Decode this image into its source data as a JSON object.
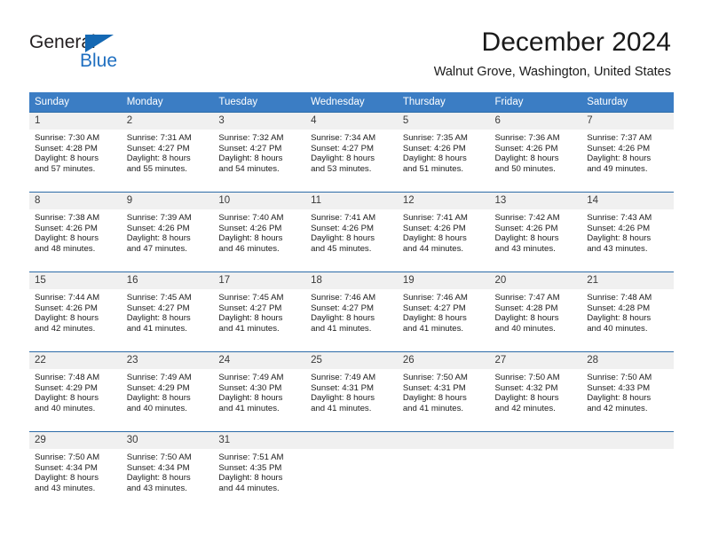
{
  "brand": {
    "name_part1": "General",
    "name_part2": "Blue",
    "triangle_color": "#1468b3"
  },
  "header": {
    "title": "December 2024",
    "location": "Walnut Grove, Washington, United States"
  },
  "colors": {
    "header_blue": "#3b7dc4",
    "cell_border_blue": "#2d6ca8",
    "daynum_band": "#f0f0f0",
    "brand_blue": "#1f6fc0"
  },
  "weekday_headers": [
    "Sunday",
    "Monday",
    "Tuesday",
    "Wednesday",
    "Thursday",
    "Friday",
    "Saturday"
  ],
  "labels": {
    "sunrise_prefix": "Sunrise:",
    "sunset_prefix": "Sunset:",
    "daylight_prefix": "Daylight:"
  },
  "weeks": [
    [
      {
        "day": "1",
        "sunrise": "Sunrise: 7:30 AM",
        "sunset": "Sunset: 4:28 PM",
        "daylight_line1": "Daylight: 8 hours",
        "daylight_line2": "and 57 minutes."
      },
      {
        "day": "2",
        "sunrise": "Sunrise: 7:31 AM",
        "sunset": "Sunset: 4:27 PM",
        "daylight_line1": "Daylight: 8 hours",
        "daylight_line2": "and 55 minutes."
      },
      {
        "day": "3",
        "sunrise": "Sunrise: 7:32 AM",
        "sunset": "Sunset: 4:27 PM",
        "daylight_line1": "Daylight: 8 hours",
        "daylight_line2": "and 54 minutes."
      },
      {
        "day": "4",
        "sunrise": "Sunrise: 7:34 AM",
        "sunset": "Sunset: 4:27 PM",
        "daylight_line1": "Daylight: 8 hours",
        "daylight_line2": "and 53 minutes."
      },
      {
        "day": "5",
        "sunrise": "Sunrise: 7:35 AM",
        "sunset": "Sunset: 4:26 PM",
        "daylight_line1": "Daylight: 8 hours",
        "daylight_line2": "and 51 minutes."
      },
      {
        "day": "6",
        "sunrise": "Sunrise: 7:36 AM",
        "sunset": "Sunset: 4:26 PM",
        "daylight_line1": "Daylight: 8 hours",
        "daylight_line2": "and 50 minutes."
      },
      {
        "day": "7",
        "sunrise": "Sunrise: 7:37 AM",
        "sunset": "Sunset: 4:26 PM",
        "daylight_line1": "Daylight: 8 hours",
        "daylight_line2": "and 49 minutes."
      }
    ],
    [
      {
        "day": "8",
        "sunrise": "Sunrise: 7:38 AM",
        "sunset": "Sunset: 4:26 PM",
        "daylight_line1": "Daylight: 8 hours",
        "daylight_line2": "and 48 minutes."
      },
      {
        "day": "9",
        "sunrise": "Sunrise: 7:39 AM",
        "sunset": "Sunset: 4:26 PM",
        "daylight_line1": "Daylight: 8 hours",
        "daylight_line2": "and 47 minutes."
      },
      {
        "day": "10",
        "sunrise": "Sunrise: 7:40 AM",
        "sunset": "Sunset: 4:26 PM",
        "daylight_line1": "Daylight: 8 hours",
        "daylight_line2": "and 46 minutes."
      },
      {
        "day": "11",
        "sunrise": "Sunrise: 7:41 AM",
        "sunset": "Sunset: 4:26 PM",
        "daylight_line1": "Daylight: 8 hours",
        "daylight_line2": "and 45 minutes."
      },
      {
        "day": "12",
        "sunrise": "Sunrise: 7:41 AM",
        "sunset": "Sunset: 4:26 PM",
        "daylight_line1": "Daylight: 8 hours",
        "daylight_line2": "and 44 minutes."
      },
      {
        "day": "13",
        "sunrise": "Sunrise: 7:42 AM",
        "sunset": "Sunset: 4:26 PM",
        "daylight_line1": "Daylight: 8 hours",
        "daylight_line2": "and 43 minutes."
      },
      {
        "day": "14",
        "sunrise": "Sunrise: 7:43 AM",
        "sunset": "Sunset: 4:26 PM",
        "daylight_line1": "Daylight: 8 hours",
        "daylight_line2": "and 43 minutes."
      }
    ],
    [
      {
        "day": "15",
        "sunrise": "Sunrise: 7:44 AM",
        "sunset": "Sunset: 4:26 PM",
        "daylight_line1": "Daylight: 8 hours",
        "daylight_line2": "and 42 minutes."
      },
      {
        "day": "16",
        "sunrise": "Sunrise: 7:45 AM",
        "sunset": "Sunset: 4:27 PM",
        "daylight_line1": "Daylight: 8 hours",
        "daylight_line2": "and 41 minutes."
      },
      {
        "day": "17",
        "sunrise": "Sunrise: 7:45 AM",
        "sunset": "Sunset: 4:27 PM",
        "daylight_line1": "Daylight: 8 hours",
        "daylight_line2": "and 41 minutes."
      },
      {
        "day": "18",
        "sunrise": "Sunrise: 7:46 AM",
        "sunset": "Sunset: 4:27 PM",
        "daylight_line1": "Daylight: 8 hours",
        "daylight_line2": "and 41 minutes."
      },
      {
        "day": "19",
        "sunrise": "Sunrise: 7:46 AM",
        "sunset": "Sunset: 4:27 PM",
        "daylight_line1": "Daylight: 8 hours",
        "daylight_line2": "and 41 minutes."
      },
      {
        "day": "20",
        "sunrise": "Sunrise: 7:47 AM",
        "sunset": "Sunset: 4:28 PM",
        "daylight_line1": "Daylight: 8 hours",
        "daylight_line2": "and 40 minutes."
      },
      {
        "day": "21",
        "sunrise": "Sunrise: 7:48 AM",
        "sunset": "Sunset: 4:28 PM",
        "daylight_line1": "Daylight: 8 hours",
        "daylight_line2": "and 40 minutes."
      }
    ],
    [
      {
        "day": "22",
        "sunrise": "Sunrise: 7:48 AM",
        "sunset": "Sunset: 4:29 PM",
        "daylight_line1": "Daylight: 8 hours",
        "daylight_line2": "and 40 minutes."
      },
      {
        "day": "23",
        "sunrise": "Sunrise: 7:49 AM",
        "sunset": "Sunset: 4:29 PM",
        "daylight_line1": "Daylight: 8 hours",
        "daylight_line2": "and 40 minutes."
      },
      {
        "day": "24",
        "sunrise": "Sunrise: 7:49 AM",
        "sunset": "Sunset: 4:30 PM",
        "daylight_line1": "Daylight: 8 hours",
        "daylight_line2": "and 41 minutes."
      },
      {
        "day": "25",
        "sunrise": "Sunrise: 7:49 AM",
        "sunset": "Sunset: 4:31 PM",
        "daylight_line1": "Daylight: 8 hours",
        "daylight_line2": "and 41 minutes."
      },
      {
        "day": "26",
        "sunrise": "Sunrise: 7:50 AM",
        "sunset": "Sunset: 4:31 PM",
        "daylight_line1": "Daylight: 8 hours",
        "daylight_line2": "and 41 minutes."
      },
      {
        "day": "27",
        "sunrise": "Sunrise: 7:50 AM",
        "sunset": "Sunset: 4:32 PM",
        "daylight_line1": "Daylight: 8 hours",
        "daylight_line2": "and 42 minutes."
      },
      {
        "day": "28",
        "sunrise": "Sunrise: 7:50 AM",
        "sunset": "Sunset: 4:33 PM",
        "daylight_line1": "Daylight: 8 hours",
        "daylight_line2": "and 42 minutes."
      }
    ],
    [
      {
        "day": "29",
        "sunrise": "Sunrise: 7:50 AM",
        "sunset": "Sunset: 4:34 PM",
        "daylight_line1": "Daylight: 8 hours",
        "daylight_line2": "and 43 minutes."
      },
      {
        "day": "30",
        "sunrise": "Sunrise: 7:50 AM",
        "sunset": "Sunset: 4:34 PM",
        "daylight_line1": "Daylight: 8 hours",
        "daylight_line2": "and 43 minutes."
      },
      {
        "day": "31",
        "sunrise": "Sunrise: 7:51 AM",
        "sunset": "Sunset: 4:35 PM",
        "daylight_line1": "Daylight: 8 hours",
        "daylight_line2": "and 44 minutes."
      },
      {
        "day": "",
        "sunrise": "",
        "sunset": "",
        "daylight_line1": "",
        "daylight_line2": ""
      },
      {
        "day": "",
        "sunrise": "",
        "sunset": "",
        "daylight_line1": "",
        "daylight_line2": ""
      },
      {
        "day": "",
        "sunrise": "",
        "sunset": "",
        "daylight_line1": "",
        "daylight_line2": ""
      },
      {
        "day": "",
        "sunrise": "",
        "sunset": "",
        "daylight_line1": "",
        "daylight_line2": ""
      }
    ]
  ]
}
